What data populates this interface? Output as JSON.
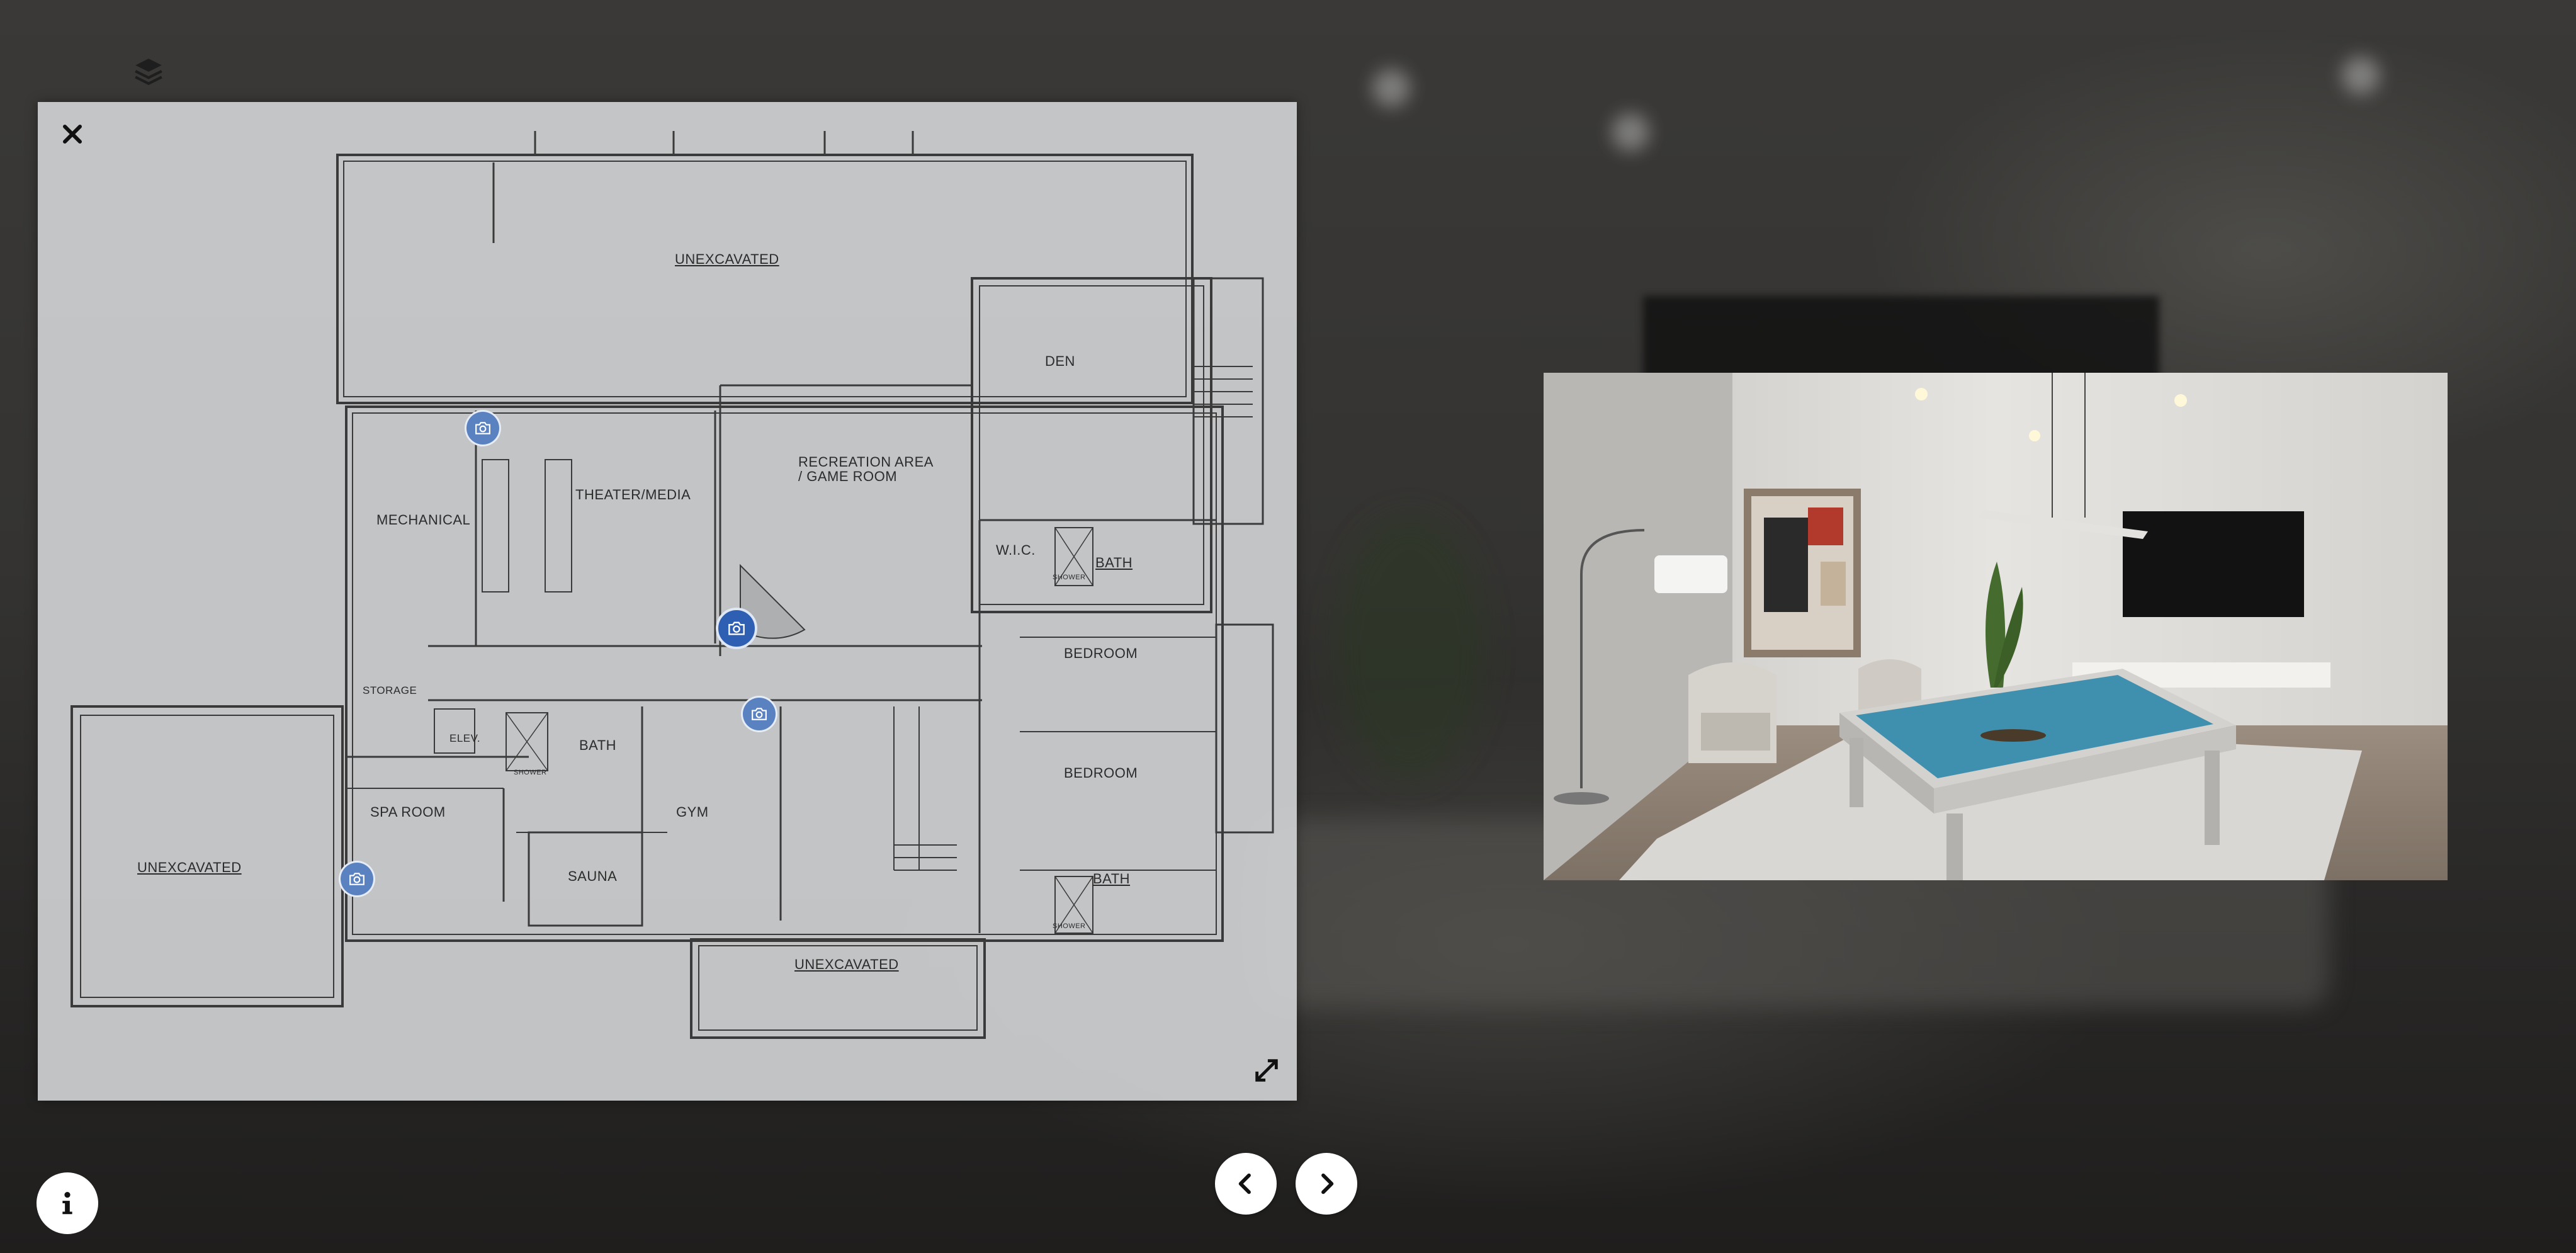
{
  "floorplan": {
    "rooms": {
      "unexcavated_top": "UNEXCAVATED",
      "den": "DEN",
      "recreation": "RECREATION AREA\n/ GAME ROOM",
      "mechanical": "MECHANICAL",
      "theater": "THEATER/MEDIA",
      "wic": "W.I.C.",
      "bath_upper": "BATH",
      "bedroom_1": "BEDROOM",
      "storage": "STORAGE",
      "elev": "ELEV.",
      "bath_mid": "BATH",
      "bedroom_2": "BEDROOM",
      "spa": "SPA ROOM",
      "gym": "GYM",
      "sauna": "SAUNA",
      "bath_lower": "BATH",
      "unexcavated_left": "UNEXCAVATED",
      "unexcavated_bottom": "UNEXCAVATED",
      "shower_1": "SHOWER",
      "shower_2": "SHOWER",
      "shower_3": "SHOWER"
    },
    "camera_pins": [
      {
        "id": "theater",
        "active": false
      },
      {
        "id": "recreation",
        "active": true
      },
      {
        "id": "gym",
        "active": false
      },
      {
        "id": "spa",
        "active": false
      }
    ]
  },
  "photo": {
    "subject": "game room render with pool table"
  },
  "icons": {
    "layers": "layers-icon",
    "close": "close-icon",
    "expand": "expand-icon",
    "prev": "chevron-left-icon",
    "next": "chevron-right-icon",
    "info": "info-icon",
    "camera": "camera-icon"
  },
  "colors": {
    "pin": "#5b82c0",
    "pin_active": "#2f5fb3",
    "panel": "#ced0d2",
    "table_felt": "#3f8fae"
  }
}
